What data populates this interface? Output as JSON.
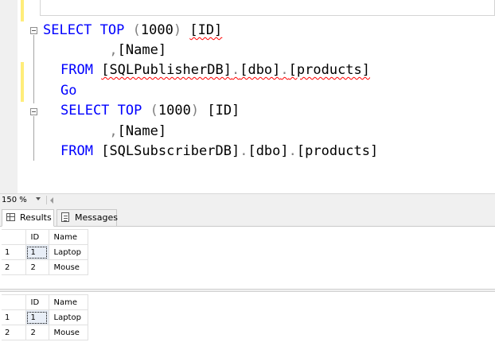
{
  "editor": {
    "lines": [
      {
        "indent": "",
        "parts": [
          {
            "t": "SELECT",
            "c": "kw"
          },
          {
            "t": " "
          },
          {
            "t": "TOP",
            "c": "kw"
          },
          {
            "t": " "
          },
          {
            "t": "(",
            "c": "gray"
          },
          {
            "t": "1000"
          },
          {
            "t": ")",
            "c": "gray"
          },
          {
            "t": " "
          },
          {
            "t": "[ID]",
            "c": "sq"
          }
        ]
      },
      {
        "indent": "",
        "parts": [
          {
            "t": "      "
          },
          {
            "t": ",",
            "c": "gray"
          },
          {
            "t": "[Name]"
          }
        ]
      },
      {
        "indent": "",
        "parts": [
          {
            "t": "FROM",
            "c": "kw"
          },
          {
            "t": " "
          },
          {
            "t": "[SQLPublisherDB]",
            "c": "sq"
          },
          {
            "t": ".",
            "c": "gray sq"
          },
          {
            "t": "[dbo]",
            "c": "sq"
          },
          {
            "t": ".",
            "c": "gray sq"
          },
          {
            "t": "[products]",
            "c": "sq"
          }
        ]
      },
      {
        "indent": "",
        "parts": [
          {
            "t": "Go",
            "c": "kw"
          }
        ]
      },
      {
        "indent": "",
        "parts": [
          {
            "t": "SELECT",
            "c": "kw"
          },
          {
            "t": " "
          },
          {
            "t": "TOP",
            "c": "kw"
          },
          {
            "t": " "
          },
          {
            "t": "(",
            "c": "gray"
          },
          {
            "t": "1000"
          },
          {
            "t": ")",
            "c": "gray"
          },
          {
            "t": " "
          },
          {
            "t": "[ID]"
          }
        ]
      },
      {
        "indent": "",
        "parts": [
          {
            "t": "      "
          },
          {
            "t": ",",
            "c": "gray"
          },
          {
            "t": "[Name]"
          }
        ]
      },
      {
        "indent": "",
        "parts": [
          {
            "t": "FROM",
            "c": "kw"
          },
          {
            "t": " "
          },
          {
            "t": "[SQLSubscriberDB]"
          },
          {
            "t": ".",
            "c": "gray"
          },
          {
            "t": "[dbo]"
          },
          {
            "t": ".",
            "c": "gray"
          },
          {
            "t": "[products]"
          }
        ]
      }
    ]
  },
  "zoom": {
    "level": "150 %"
  },
  "tabs": {
    "results": "Results",
    "messages": "Messages"
  },
  "grids": [
    {
      "headers": [
        "ID",
        "Name"
      ],
      "rows": [
        {
          "num": "1",
          "id": "1",
          "name": "Laptop"
        },
        {
          "num": "2",
          "id": "2",
          "name": "Mouse"
        }
      ]
    },
    {
      "headers": [
        "ID",
        "Name"
      ],
      "rows": [
        {
          "num": "1",
          "id": "1",
          "name": "Laptop"
        },
        {
          "num": "2",
          "id": "2",
          "name": "Mouse"
        }
      ]
    }
  ],
  "colors": {
    "keyword": "#0000ff",
    "squiggle": "#ff0000",
    "change_marker": "#ffed7a"
  }
}
